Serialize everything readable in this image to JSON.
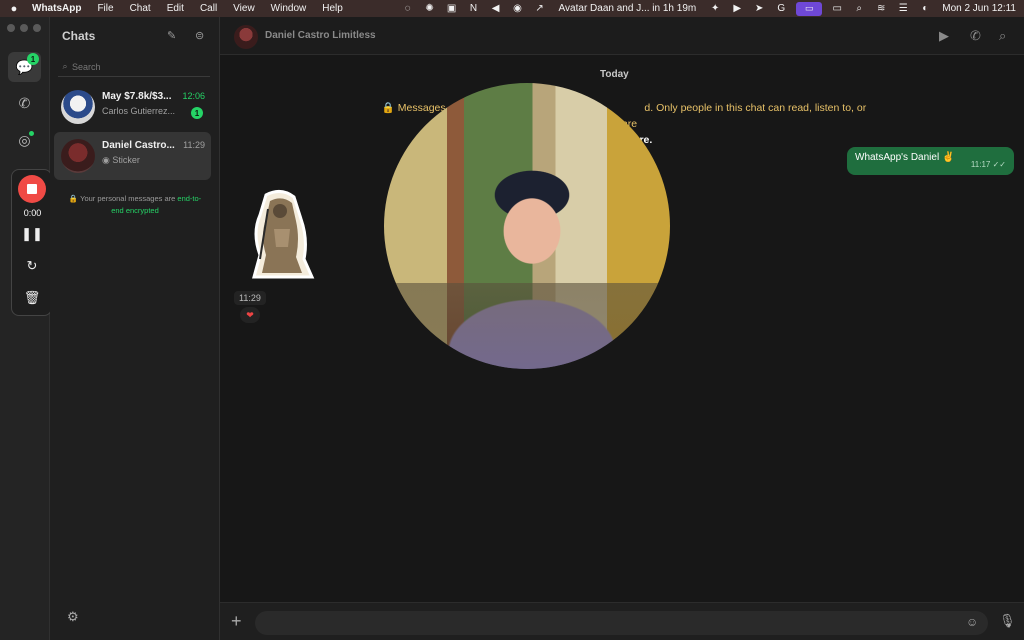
{
  "menubar": {
    "apple": "",
    "app_name": "WhatsApp",
    "menus": [
      "File",
      "Chat",
      "Edit",
      "Call",
      "View",
      "Window",
      "Help"
    ],
    "event": "Avatar Daan and J... in 1h 19m",
    "datetime": "Mon 2 Jun  12:11"
  },
  "rail": {
    "chats_badge": "1",
    "recorder_time": "0:00"
  },
  "chat_list": {
    "title": "Chats",
    "search_placeholder": "Search",
    "items": [
      {
        "name": "May $7.8k/$3...",
        "sub": "Carlos Gutierrez...",
        "time": "12:06",
        "badge": "1"
      },
      {
        "name": "Daniel Castro...",
        "sub": "Sticker",
        "time": "11:29"
      }
    ],
    "encryption_note_prefix": "Your personal messages are ",
    "encryption_note_link": "end-to-end encrypted"
  },
  "conversation": {
    "contact_name": "Daniel Castro Limitless",
    "day_label": "Today",
    "system_message_a": "Messages a",
    "system_message_b": "d. Only people in this chat can read, listen to, or share",
    "system_message_link": "learn more.",
    "outgoing_text": "WhatsApp's Daniel ✌️",
    "outgoing_time": "11:17",
    "sticker_time": "11:29",
    "reaction": "❤"
  },
  "colors": {
    "accent": "#25d366",
    "outgoing_bubble": "#1f6e3e",
    "system_text": "#e7c168",
    "record_button": "#f04a45",
    "menubar_highlight": "#6f48d6"
  }
}
